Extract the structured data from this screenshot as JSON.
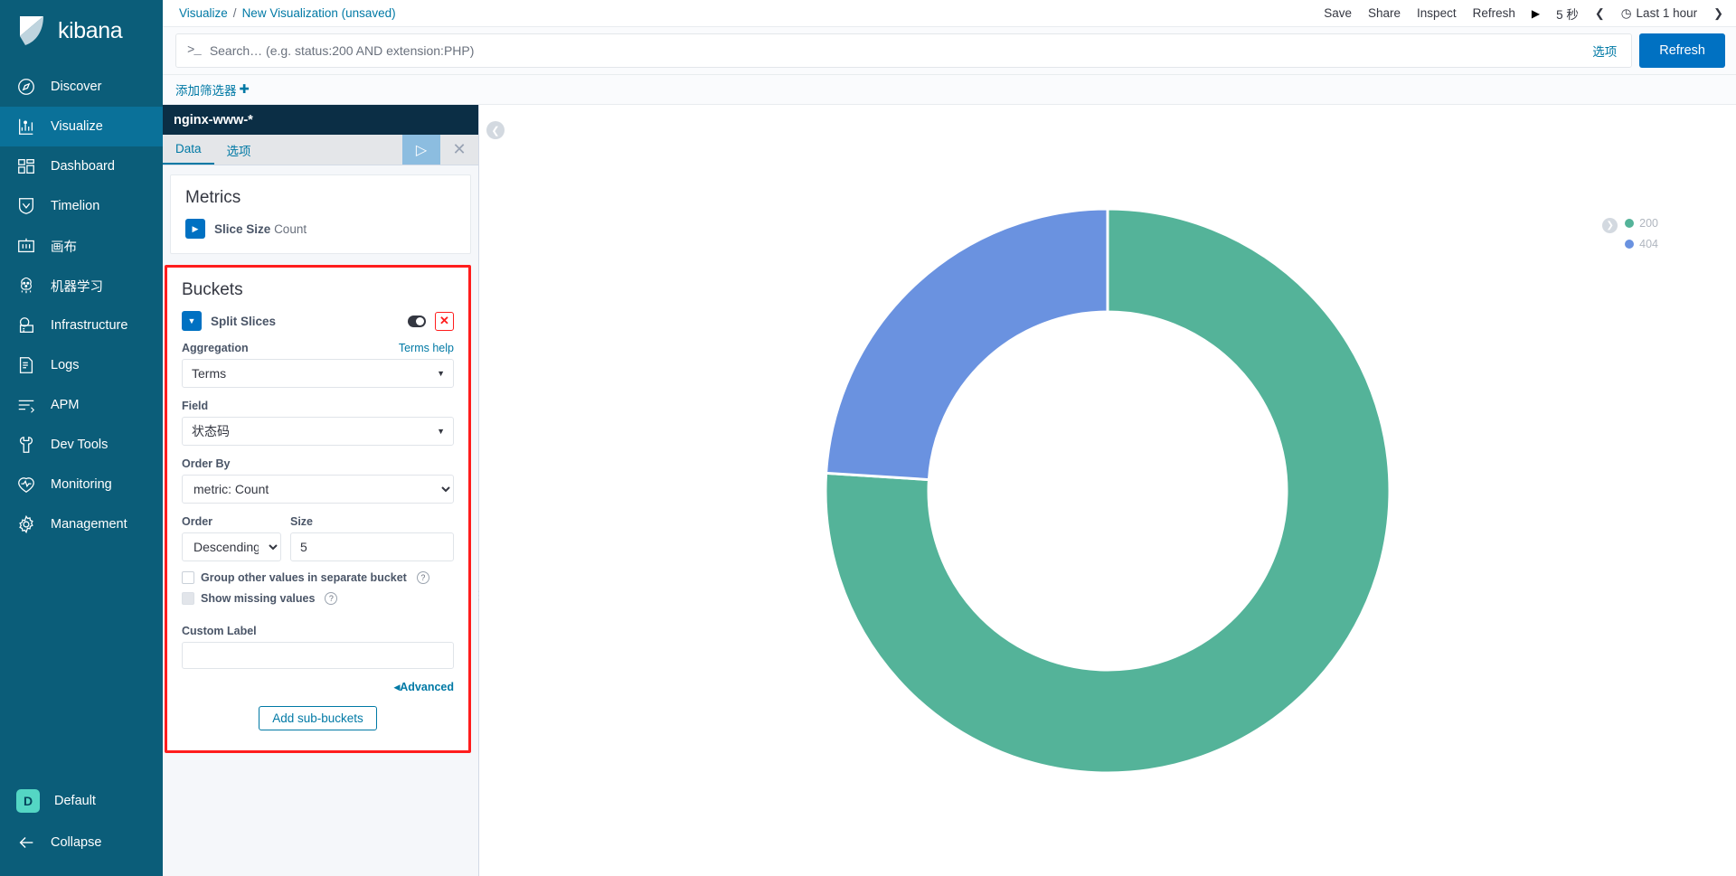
{
  "brand": {
    "name": "kibana"
  },
  "sidebar": {
    "items": [
      {
        "label": "Discover",
        "icon": "compass-icon",
        "active": false
      },
      {
        "label": "Visualize",
        "icon": "chart-icon",
        "active": true
      },
      {
        "label": "Dashboard",
        "icon": "dashboard-icon",
        "active": false
      },
      {
        "label": "Timelion",
        "icon": "timelion-icon",
        "active": false
      },
      {
        "label": "画布",
        "icon": "canvas-icon",
        "active": false
      },
      {
        "label": "机器学习",
        "icon": "machine-learning-icon",
        "active": false
      },
      {
        "label": "Infrastructure",
        "icon": "infrastructure-icon",
        "active": false
      },
      {
        "label": "Logs",
        "icon": "logs-icon",
        "active": false
      },
      {
        "label": "APM",
        "icon": "apm-icon",
        "active": false
      },
      {
        "label": "Dev Tools",
        "icon": "wrench-icon",
        "active": false
      },
      {
        "label": "Monitoring",
        "icon": "monitoring-icon",
        "active": false
      },
      {
        "label": "Management",
        "icon": "gear-icon",
        "active": false
      }
    ],
    "space": {
      "badge": "D",
      "label": "Default"
    },
    "collapse": {
      "label": "Collapse"
    }
  },
  "breadcrumb": {
    "parent": "Visualize",
    "separator": "/",
    "current": "New Visualization (unsaved)"
  },
  "toolbar": {
    "save_label": "Save",
    "share_label": "Share",
    "inspect_label": "Inspect",
    "refresh_label": "Refresh",
    "play_glyph": "▶",
    "interval": "5 秒",
    "prev_glyph": "❮",
    "clock_glyph": "◷",
    "time_range": "Last 1 hour",
    "next_glyph": "❯"
  },
  "query": {
    "prompt": ">_",
    "value": "",
    "placeholder": "Search… (e.g. status:200 AND extension:PHP)",
    "options_label": "选项",
    "refresh_button": "Refresh"
  },
  "filters": {
    "add_label": "添加筛选器",
    "add_glyph": "✚"
  },
  "editor": {
    "data_source": "nginx-www-*",
    "tabs": [
      {
        "label": "Data",
        "active": true
      },
      {
        "label": "选项",
        "active": false
      }
    ],
    "apply_glyph": "▷",
    "close_glyph": "✕",
    "metrics": {
      "title": "Metrics",
      "agg_name": "Slice Size",
      "agg_detail": "Count",
      "toggle_glyph": "▶"
    },
    "buckets": {
      "title": "Buckets",
      "bucket_name": "Split Slices",
      "toggle_glyph": "▼",
      "remove_glyph": "✕",
      "aggregation_label": "Aggregation",
      "terms_help": "Terms help",
      "aggregation_value": "Terms",
      "field_label": "Field",
      "field_value": "状态码",
      "order_by_label": "Order By",
      "order_by_value": "metric: Count",
      "order_label": "Order",
      "order_value": "Descending",
      "size_label": "Size",
      "size_value": "5",
      "group_other_label": "Group other values in separate bucket",
      "show_missing_label": "Show missing values",
      "help_glyph": "?",
      "custom_label_label": "Custom Label",
      "custom_label_value": "",
      "custom_label_placeholder": "",
      "advanced_label": "Advanced",
      "advanced_glyph": "◂",
      "add_sub_buckets": "Add sub-buckets"
    }
  },
  "chart_data": {
    "type": "pie",
    "variant": "donut",
    "title": "",
    "labels": [
      "200",
      "404"
    ],
    "values": [
      76,
      24
    ],
    "colors": [
      "#54b399",
      "#6a92e0"
    ],
    "legend_position": "right",
    "start_angle_deg": 0,
    "direction": "clockwise"
  },
  "chart_ui": {
    "collapse_glyph": "❮",
    "legend_toggle_glyph": "❯"
  }
}
